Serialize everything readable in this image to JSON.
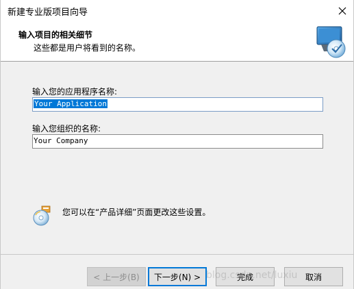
{
  "window": {
    "title": "新建专业版项目向导"
  },
  "header": {
    "title": "输入项目的相关细节",
    "subtitle": "这些都是用户将看到的名称。"
  },
  "form": {
    "app_name_label": "输入您的应用程序名称:",
    "app_name_value": "Your Application",
    "org_name_label": "输入您组织的名称:",
    "org_name_value": "Your Company"
  },
  "info": {
    "text": "您可以在“产品详细”页面更改这些设置。"
  },
  "buttons": {
    "back": "< 上一步(B)",
    "next": "下一步(N) >",
    "finish": "完成",
    "cancel": "取消"
  },
  "watermark": "blog.csdn.net/luxiu",
  "colors": {
    "accent": "#0078d7",
    "background": "#f0f0f0"
  },
  "icons": {
    "close": "close-icon",
    "logo": "wizard-logo-icon",
    "info": "cd-info-icon"
  }
}
